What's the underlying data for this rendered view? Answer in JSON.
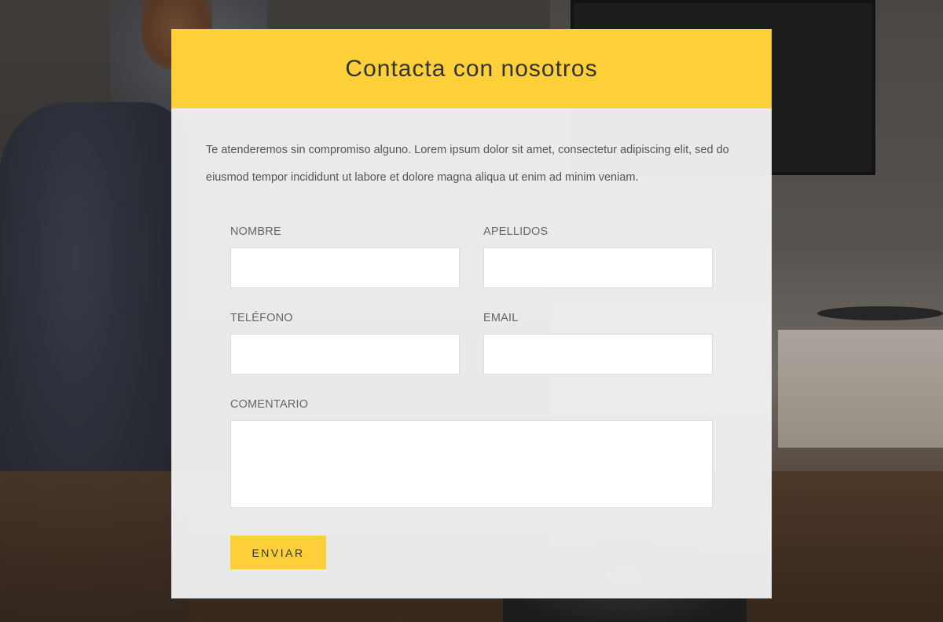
{
  "form": {
    "title": "Contacta con nosotros",
    "intro": "Te atenderemos sin compromiso alguno. Lorem ipsum dolor sit amet, consectetur adipiscing elit, sed do eiusmod tempor incididunt ut labore et dolore magna aliqua ut enim ad minim veniam.",
    "fields": {
      "nombre": {
        "label": "NOMBRE",
        "value": ""
      },
      "apellidos": {
        "label": "APELLIDOS",
        "value": ""
      },
      "telefono": {
        "label": "TELÉFONO",
        "value": ""
      },
      "email": {
        "label": "EMAIL",
        "value": ""
      },
      "comentario": {
        "label": "COMENTARIO",
        "value": ""
      }
    },
    "submit_label": "ENVIAR"
  },
  "colors": {
    "accent": "#fdd03a",
    "card_background": "#f1f1f2",
    "heading_text": "#333333",
    "body_text": "#555555",
    "label_text": "#666666"
  }
}
